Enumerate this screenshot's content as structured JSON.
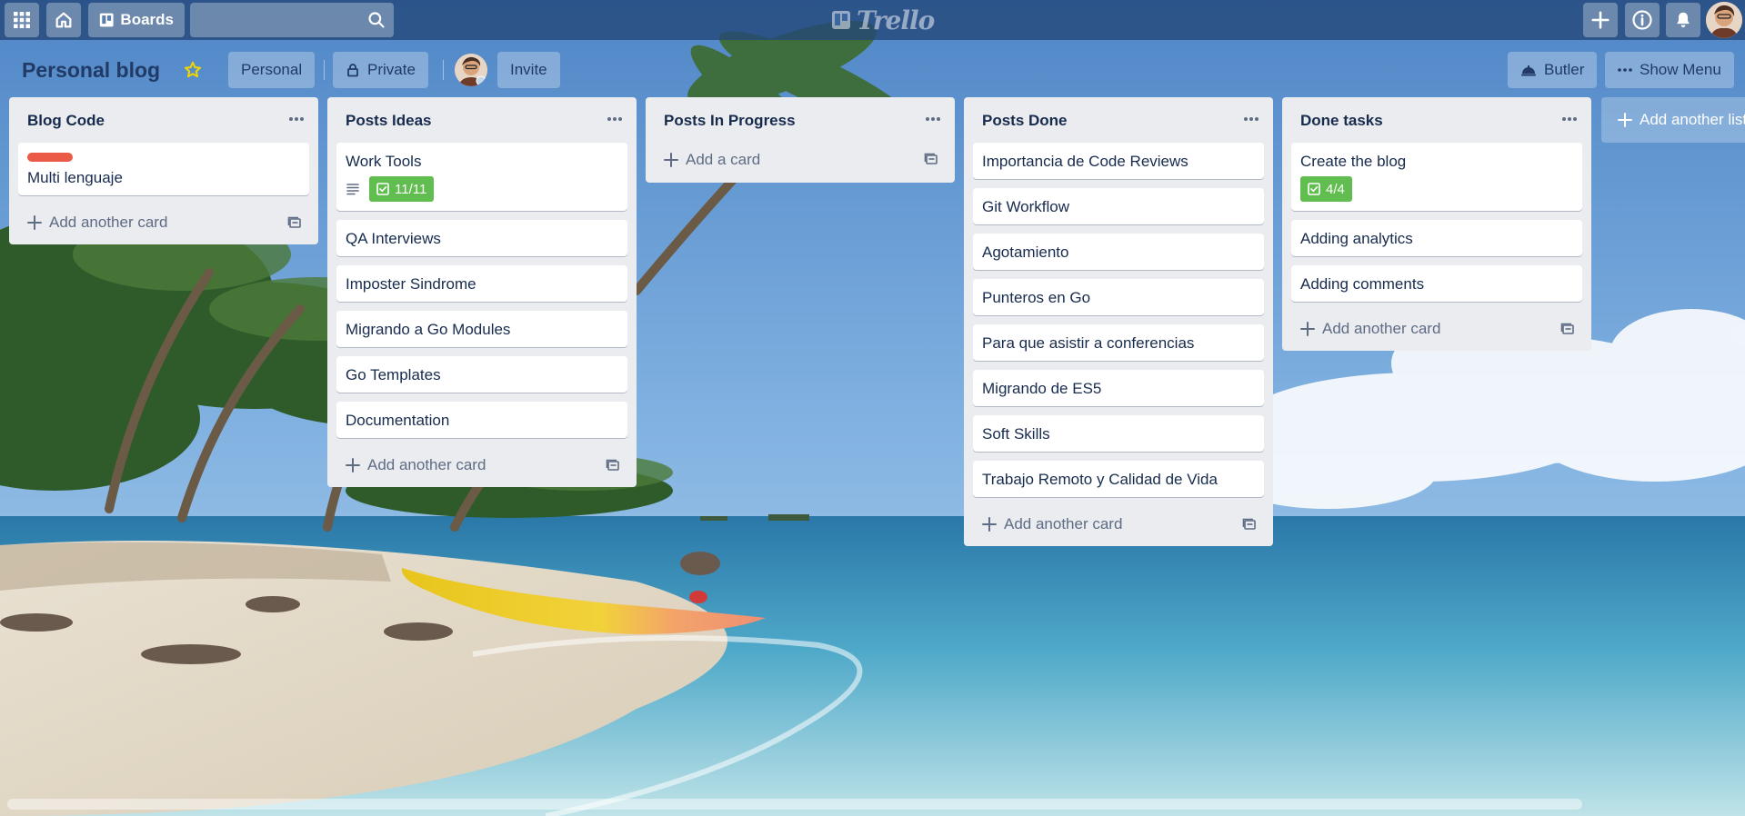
{
  "topbar": {
    "boards_label": "Boards",
    "search_value": "",
    "logo_text": "Trello"
  },
  "board": {
    "title": "Personal blog",
    "team_label": "Personal",
    "visibility_label": "Private",
    "invite_label": "Invite",
    "butler_label": "Butler",
    "menu_label": "Show Menu"
  },
  "lists": [
    {
      "title": "Blog Code",
      "cards": [
        {
          "title": "Multi lenguaje",
          "label_color": "#eb5a46"
        }
      ],
      "add_label": "Add another card"
    },
    {
      "title": "Posts Ideas",
      "cards": [
        {
          "title": "Work Tools",
          "checklist": "11/11",
          "has_description": true
        },
        {
          "title": "QA Interviews"
        },
        {
          "title": "Imposter Sindrome"
        },
        {
          "title": "Migrando a Go Modules"
        },
        {
          "title": "Go Templates"
        },
        {
          "title": "Documentation"
        }
      ],
      "add_label": "Add another card"
    },
    {
      "title": "Posts In Progress",
      "cards": [],
      "add_label": "Add a card"
    },
    {
      "title": "Posts Done",
      "cards": [
        {
          "title": "Importancia de Code Reviews"
        },
        {
          "title": "Git Workflow"
        },
        {
          "title": "Agotamiento"
        },
        {
          "title": "Punteros en Go"
        },
        {
          "title": "Para que asistir a conferencias"
        },
        {
          "title": "Migrando de ES5"
        },
        {
          "title": "Soft Skills"
        },
        {
          "title": "Trabajo Remoto y Calidad de Vida"
        }
      ],
      "add_label": "Add another card"
    },
    {
      "title": "Done tasks",
      "cards": [
        {
          "title": "Create the blog",
          "checklist": "4/4"
        },
        {
          "title": "Adding analytics"
        },
        {
          "title": "Adding comments"
        }
      ],
      "add_label": "Add another card"
    }
  ],
  "add_list_label": "Add another list",
  "colors": {
    "topbar": "#23467a",
    "list_bg": "#ebecf0",
    "label_red": "#eb5a46",
    "checklist_green": "#61bd4f",
    "star": "#f2d600"
  }
}
